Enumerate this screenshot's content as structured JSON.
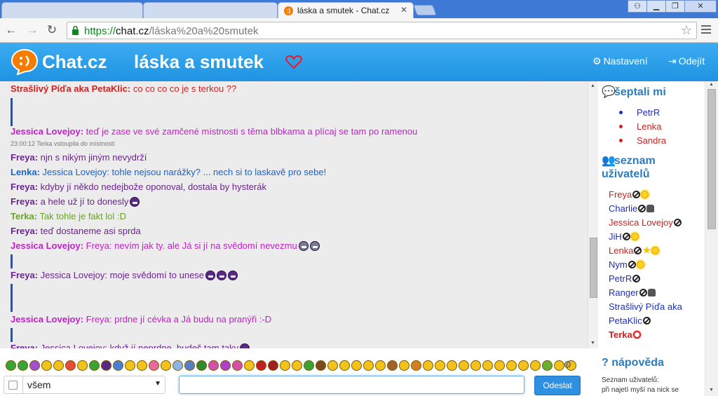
{
  "browser": {
    "active_tab_title": "láska a smutek - Chat.cz",
    "url_scheme": "https://",
    "url_host": "chat.cz",
    "url_path": "/láska%20a%20smutek",
    "window_buttons": [
      "user",
      "minimize",
      "maximize",
      "close"
    ]
  },
  "header": {
    "site_name": "Chat.cz",
    "room_name": "láska a smutek",
    "settings_label": "Nastavení",
    "logout_label": "Odejít",
    "accent_color": "#2ea3ee",
    "heart_color": "#e02030"
  },
  "messages": [
    {
      "type": "msg",
      "nick": "Strašlivý Píďa aka PetaKlic:",
      "text": " co co co co je s terkou ??",
      "color": "#d21f1f"
    },
    {
      "type": "bar"
    },
    {
      "type": "bar"
    },
    {
      "type": "msg",
      "nick": "Jessica Lovejoy:",
      "text": " teď je zase ve své zamčené místnosti s těma blbkama a plícaj se tam po ramenou",
      "color": "#c21fc9"
    },
    {
      "type": "sys",
      "text": "23:00:12 Terka vstoupila do místnosti"
    },
    {
      "type": "msg",
      "nick": "Freya:",
      "text": " njn s nikým jiným nevydrží",
      "color": "#6a238e"
    },
    {
      "type": "msg",
      "nick": "Lenka:",
      "text": " Jessica Lovejoy: tohle nejsou narážky? ... nech si to laskavě pro sebe!",
      "color": "#1a63c9"
    },
    {
      "type": "msg",
      "nick": "Freya:",
      "text": " kdyby jí někdo nedejbože oponoval, dostala by hysterák",
      "color": "#6a238e"
    },
    {
      "type": "msg",
      "nick": "Freya:",
      "text": " a hele už jí to donesly",
      "color": "#6a238e",
      "smileys": 1
    },
    {
      "type": "msg",
      "nick": "Terka:",
      "text": " Tak tohle je fakt lol :D",
      "color": "#6aa22a"
    },
    {
      "type": "msg",
      "nick": "Freya:",
      "text": " teď dostaneme asi sprda",
      "color": "#6a238e"
    },
    {
      "type": "msg",
      "nick": "Jessica Lovejoy:",
      "text": " Freya: nevím jak ty. ale Já si jí na svědomí nevezmu",
      "color": "#c21fc9",
      "smileys": 2,
      "grey": true
    },
    {
      "type": "bar"
    },
    {
      "type": "msg",
      "nick": "Freya:",
      "text": " Jessica Lovejoy: moje svědomí to unese",
      "color": "#6a238e",
      "smileys": 3
    },
    {
      "type": "bar"
    },
    {
      "type": "bar"
    },
    {
      "type": "msg",
      "nick": "Jessica Lovejoy:",
      "text": " Freya: prdne jí cévka a Já budu na pranýři :-D",
      "color": "#c21fc9"
    },
    {
      "type": "bar"
    },
    {
      "type": "msg",
      "nick": "Freya:",
      "text": " Jessica Lovejoy: když jí neprdne, budeš tam taky",
      "color": "#6a238e",
      "smileys": 1
    }
  ],
  "sidebar": {
    "whisper_title": "šeptali mi",
    "whispers": [
      {
        "name": "PetrR",
        "color": "#1a2fc9"
      },
      {
        "name": "Lenka",
        "color": "#d21f1f"
      },
      {
        "name": "Sandra",
        "color": "#d21f1f"
      }
    ],
    "users_title_1": "seznam",
    "users_title_2": "uživatelů",
    "users": [
      {
        "name": "Freya",
        "color": "#d21f1f",
        "icons": [
          "block",
          "sun"
        ]
      },
      {
        "name": "Charlie",
        "color": "#1a2fc9",
        "icons": [
          "block",
          "agent"
        ]
      },
      {
        "name": "Jessica Lovejoy",
        "color": "#d21f1f",
        "icons": [
          "block"
        ]
      },
      {
        "name": "JiH",
        "color": "#1a2fc9",
        "icons": [
          "block",
          "sun"
        ]
      },
      {
        "name": "Lenka",
        "color": "#d21f1f",
        "icons": [
          "block",
          "star",
          "sun"
        ]
      },
      {
        "name": "Nym",
        "color": "#1a2fc9",
        "icons": [
          "block",
          "sun"
        ]
      },
      {
        "name": "PetrR",
        "color": "#1a2fc9",
        "icons": [
          "block"
        ]
      },
      {
        "name": "Ranger",
        "color": "#1a2fc9",
        "icons": [
          "block",
          "agent"
        ]
      },
      {
        "name": "Strašlivý Píďa aka",
        "color": "#1a2fc9",
        "icons": []
      },
      {
        "name": "PetaKlic",
        "color": "#1a2fc9",
        "icons": [
          "block"
        ]
      },
      {
        "name": "Terka",
        "color": "#d21f1f",
        "icons": [
          "sun-red"
        ],
        "bold": true
      }
    ],
    "help_title": "nápověda",
    "help_line1": "Seznam uživatelů:",
    "help_line2": "při najetí myší na nick se"
  },
  "composer": {
    "recipient_value": "všem",
    "input_value": "",
    "send_label": "Odeslat"
  },
  "smiley_colors": [
    "#3aa336",
    "#3aa336",
    "#a34fd0",
    "#f3c21b",
    "#f3c21b",
    "#e74c3c",
    "#f3c21b",
    "#3aa336",
    "#5b2a86",
    "#4a7fd6",
    "#f3c21b",
    "#f3c21b",
    "#e86aa0",
    "#f3c21b",
    "#8bb4e8",
    "#5a7fc4",
    "#2d8a2d",
    "#d64fa8",
    "#b03fd0",
    "#d64fa8",
    "#f3c21b",
    "#c22020",
    "#a02020",
    "#f3c21b",
    "#f3c21b",
    "#3aa336",
    "#7b4a1e",
    "#f3c21b",
    "#f3c21b",
    "#f3c21b",
    "#f3c21b",
    "#f3c21b",
    "#a0622a",
    "#f3c21b",
    "#d08020",
    "#f3c21b",
    "#f3c21b",
    "#f3c21b",
    "#f3c21b",
    "#f3c21b",
    "#f3c21b",
    "#f3c21b",
    "#f3c21b",
    "#f3c21b",
    "#f3c21b",
    "#6ab030",
    "#f3c21b",
    "#f3c21b"
  ]
}
